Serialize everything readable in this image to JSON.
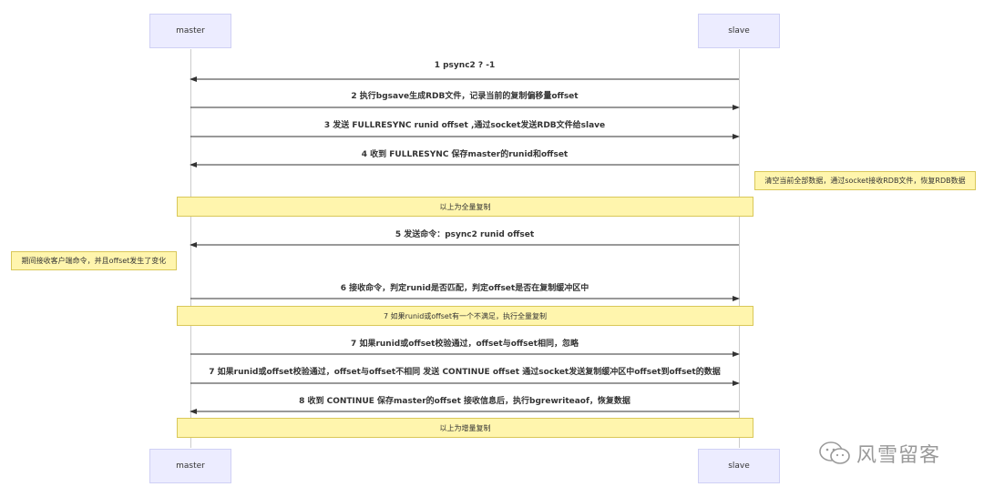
{
  "actors": {
    "top_left": "master",
    "top_right": "slave",
    "bottom_left": "master",
    "bottom_right": "slave"
  },
  "messages": [
    {
      "text": "1 psync2 ? -1",
      "direction": "to-master"
    },
    {
      "text": "2 执行bgsave生成RDB文件，记录当前的复制偏移量offset",
      "direction": "to-slave"
    },
    {
      "text": "3 发送 FULLRESYNC runid offset ,通过socket发送RDB文件给slave",
      "direction": "to-slave"
    },
    {
      "text": "4 收到 FULLRESYNC 保存master的runid和offset",
      "direction": "to-master"
    },
    {
      "text": "5 发送命令：psync2 runid offset",
      "direction": "to-master"
    },
    {
      "text": "6 接收命令，判定runid是否匹配，判定offset是否在复制缓冲区中",
      "direction": "to-slave"
    },
    {
      "text": "7 如果runid或offset校验通过，offset与offset相同，忽略",
      "direction": "to-slave"
    },
    {
      "text": "7 如果runid或offset校验通过，offset与offset不相同 发送 CONTINUE offset 通过socket发送复制缓冲区中offset到offset的数据",
      "direction": "to-slave"
    },
    {
      "text": "8 收到 CONTINUE 保存master的offset 接收信息后，执行bgrewriteaof，恢复数据",
      "direction": "to-master"
    }
  ],
  "notes": {
    "slave_restore": "清空当前全部数据，通过socket接收RDB文件，恢复RDB数据",
    "full_copy": "以上为全量复制",
    "master_change": "期间接收客户端命令，并且offset发生了变化",
    "fallback_full": "7 如果runid或offset有一个不满足，执行全量复制",
    "incremental": "以上为增量复制"
  },
  "watermark": "风雪留客",
  "colors": {
    "actor_fill": "#ececff",
    "actor_border": "#cfd0f5",
    "note_fill": "#fff5ad",
    "note_border": "#d9c758",
    "arrow": "#333333"
  }
}
